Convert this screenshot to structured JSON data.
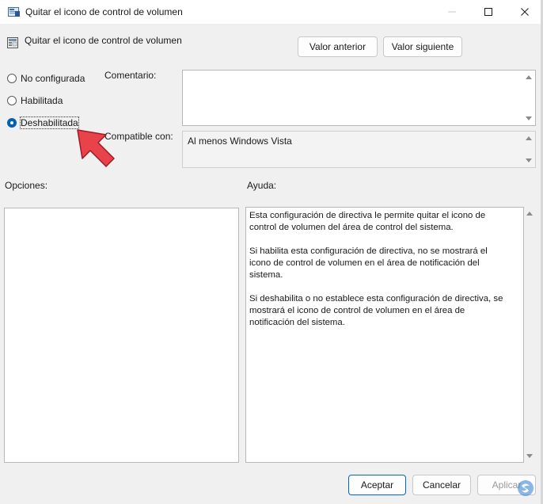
{
  "window": {
    "title": "Quitar el icono de control de volumen",
    "controls": [
      "minimize",
      "maximize",
      "close"
    ]
  },
  "header": {
    "policy_name": "Quitar el icono de control de volumen",
    "prev_button": "Valor anterior",
    "next_button": "Valor siguiente"
  },
  "state_options": [
    {
      "label": "No configurada",
      "checked": false
    },
    {
      "label": "Habilitada",
      "checked": false
    },
    {
      "label": "Deshabilitada",
      "checked": true
    }
  ],
  "comment": {
    "label": "Comentario:",
    "value": ""
  },
  "supported": {
    "label": "Compatible con:",
    "value": "Al menos Windows Vista"
  },
  "options": {
    "label": "Opciones:"
  },
  "help": {
    "label": "Ayuda:",
    "paragraphs": [
      "Esta configuración de directiva le permite quitar el icono de control de volumen del área de control del sistema.",
      "Si habilita esta configuración de directiva, no se mostrará el icono de control de volumen en el área de notificación del sistema.",
      "Si deshabilita o no establece esta configuración de directiva, se mostrará el icono de control de volumen en el área de notificación del sistema."
    ]
  },
  "footer": {
    "ok": "Aceptar",
    "cancel": "Cancelar",
    "apply": "Aplicar"
  },
  "colors": {
    "accent": "#005fb8",
    "annotation_arrow": "#e8434a",
    "dialog_bg": "#f0f0f0"
  },
  "icons": [
    "app-policy-icon",
    "policy-setting-icon",
    "minimize-icon",
    "maximize-icon",
    "close-icon",
    "scroll-up-icon",
    "scroll-down-icon",
    "red-pointer-arrow",
    "watermark-logo"
  ]
}
